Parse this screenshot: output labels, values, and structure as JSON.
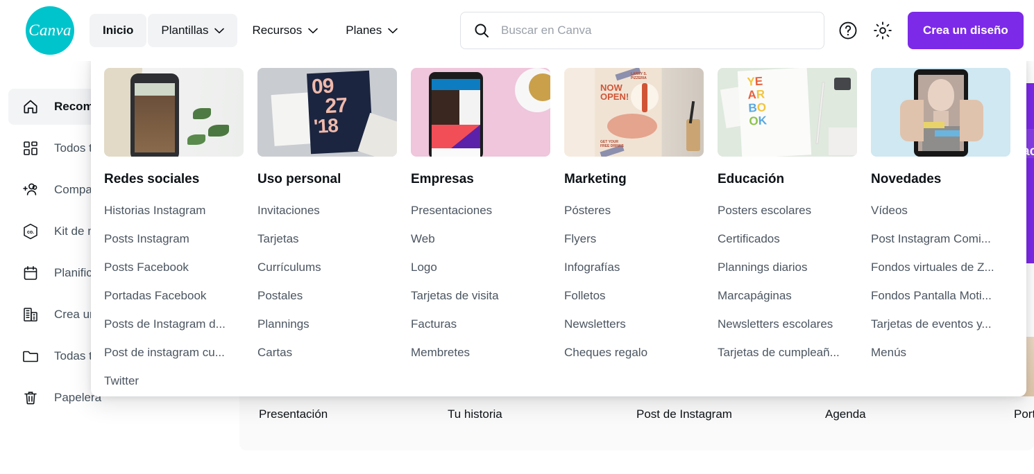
{
  "header": {
    "logo_label": "Canva",
    "nav": [
      {
        "label": "Inicio",
        "state": "active",
        "has_chevron": false
      },
      {
        "label": "Plantillas",
        "state": "open",
        "has_chevron": true
      },
      {
        "label": "Recursos",
        "state": "normal",
        "has_chevron": true
      },
      {
        "label": "Planes",
        "state": "normal",
        "has_chevron": true
      }
    ],
    "search": {
      "placeholder": "Buscar en Canva",
      "value": ""
    },
    "help_icon": "question-circle-icon",
    "settings_icon": "gear-icon",
    "cta_label": "Crea un diseño",
    "accent_color": "#7d2ae8",
    "brand_color": "#00c4cc"
  },
  "sidebar": {
    "items": [
      {
        "label": "Recomendado",
        "icon": "home-icon",
        "active": true
      },
      {
        "label": "Todos tus diseños",
        "icon": "grid-icon",
        "active": false
      },
      {
        "label": "Compartido contigo",
        "icon": "add-people-icon",
        "active": false
      },
      {
        "label": "Kit de marca",
        "icon": "brand-kit-icon",
        "active": false
      },
      {
        "label": "Planificador de contenido",
        "icon": "calendar-icon",
        "active": false
      },
      {
        "label": "Crea un equipo",
        "icon": "building-icon",
        "active": false
      },
      {
        "label": "Todas tus carpetas",
        "icon": "folder-icon",
        "active": false
      },
      {
        "label": "Papelera",
        "icon": "trash-icon",
        "active": false
      }
    ]
  },
  "megamenu": {
    "columns": [
      {
        "title": "Redes sociales",
        "thumb": "phone-instagram-story-thumbnail",
        "links": [
          "Historias Instagram",
          "Posts Instagram",
          "Posts Facebook",
          "Portadas Facebook",
          "Posts de Instagram d...",
          "Post de instagram cu...",
          "Twitter"
        ]
      },
      {
        "title": "Uso personal",
        "thumb": "save-the-date-card-thumbnail",
        "links": [
          "Invitaciones",
          "Tarjetas",
          "Currículums",
          "Postales",
          "Plannings",
          "Cartas"
        ]
      },
      {
        "title": "Empresas",
        "thumb": "phone-app-ad-thumbnail",
        "links": [
          "Presentaciones",
          "Web",
          "Logo",
          "Tarjetas de visita",
          "Facturas",
          "Membretes"
        ]
      },
      {
        "title": "Marketing",
        "thumb": "pizza-now-open-poster-thumbnail",
        "links": [
          "Pósteres",
          "Flyers",
          "Infografías",
          "Folletos",
          "Newsletters",
          "Cheques regalo"
        ]
      },
      {
        "title": "Educación",
        "thumb": "yearbook-thumbnail",
        "links": [
          "Posters escolares",
          "Certificados",
          "Plannings diarios",
          "Marcapáginas",
          "Newsletters escolares",
          "Tarjetas de cumpleañ..."
        ]
      },
      {
        "title": "Novedades",
        "thumb": "phone-video-selfie-thumbnail",
        "links": [
          "Vídeos",
          "Post Instagram Comi...",
          "Fondos virtuales de Z...",
          "Fondos Pantalla Moti...",
          "Tarjetas de eventos y...",
          "Menús"
        ]
      }
    ]
  },
  "content": {
    "thumbnails": [
      {
        "label": "Presentación"
      },
      {
        "label": "Tu historia"
      },
      {
        "label": "Post de Instagram"
      },
      {
        "label": "Agenda"
      },
      {
        "label": "Portada de Facebook"
      }
    ],
    "promo_text": "ac"
  }
}
